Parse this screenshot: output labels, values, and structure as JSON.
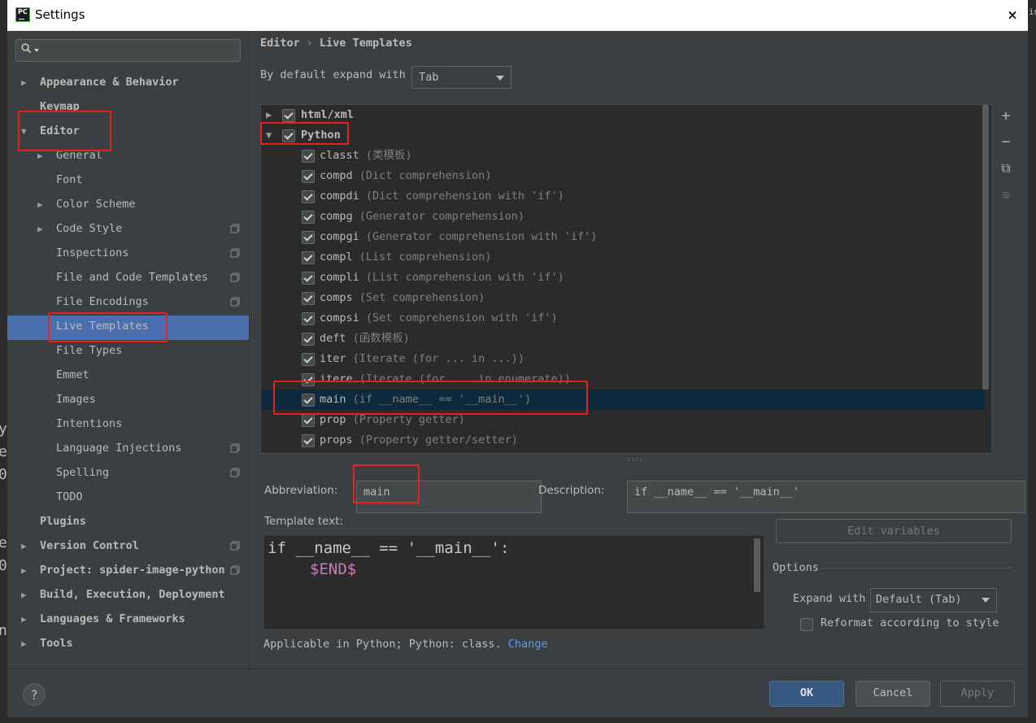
{
  "window": {
    "title": "Settings",
    "app_icon": "pycharm-icon",
    "close_icon": "×"
  },
  "background_text": {
    "left": [
      "y",
      "e",
      "0",
      "e",
      "0",
      "n"
    ],
    "right_top": "in"
  },
  "sidebar": {
    "search_placeholder": "",
    "items": [
      {
        "label": "Appearance & Behavior",
        "level": 0,
        "bold": true,
        "arrow": "▶",
        "copy": false
      },
      {
        "label": "Keymap",
        "level": 0,
        "bold": true,
        "arrow": "",
        "copy": false
      },
      {
        "label": "Editor",
        "level": 0,
        "bold": true,
        "arrow": "▼",
        "copy": false
      },
      {
        "label": "General",
        "level": 1,
        "bold": false,
        "arrow": "▶",
        "copy": false
      },
      {
        "label": "Font",
        "level": 1,
        "bold": false,
        "arrow": "",
        "copy": false
      },
      {
        "label": "Color Scheme",
        "level": 1,
        "bold": false,
        "arrow": "▶",
        "copy": false
      },
      {
        "label": "Code Style",
        "level": 1,
        "bold": false,
        "arrow": "▶",
        "copy": true
      },
      {
        "label": "Inspections",
        "level": 1,
        "bold": false,
        "arrow": "",
        "copy": true
      },
      {
        "label": "File and Code Templates",
        "level": 1,
        "bold": false,
        "arrow": "",
        "copy": true
      },
      {
        "label": "File Encodings",
        "level": 1,
        "bold": false,
        "arrow": "",
        "copy": true
      },
      {
        "label": "Live Templates",
        "level": 1,
        "bold": false,
        "arrow": "",
        "copy": false,
        "selected": true
      },
      {
        "label": "File Types",
        "level": 1,
        "bold": false,
        "arrow": "",
        "copy": false
      },
      {
        "label": "Emmet",
        "level": 1,
        "bold": false,
        "arrow": "",
        "copy": false
      },
      {
        "label": "Images",
        "level": 1,
        "bold": false,
        "arrow": "",
        "copy": false
      },
      {
        "label": "Intentions",
        "level": 1,
        "bold": false,
        "arrow": "",
        "copy": false
      },
      {
        "label": "Language Injections",
        "level": 1,
        "bold": false,
        "arrow": "",
        "copy": true
      },
      {
        "label": "Spelling",
        "level": 1,
        "bold": false,
        "arrow": "",
        "copy": true
      },
      {
        "label": "TODO",
        "level": 1,
        "bold": false,
        "arrow": "",
        "copy": false
      },
      {
        "label": "Plugins",
        "level": 0,
        "bold": true,
        "arrow": "",
        "copy": false
      },
      {
        "label": "Version Control",
        "level": 0,
        "bold": true,
        "arrow": "▶",
        "copy": true
      },
      {
        "label": "Project: spider-image-python",
        "level": 0,
        "bold": true,
        "arrow": "▶",
        "copy": true
      },
      {
        "label": "Build, Execution, Deployment",
        "level": 0,
        "bold": true,
        "arrow": "▶",
        "copy": false
      },
      {
        "label": "Languages & Frameworks",
        "level": 0,
        "bold": true,
        "arrow": "▶",
        "copy": false
      },
      {
        "label": "Tools",
        "level": 0,
        "bold": true,
        "arrow": "▶",
        "copy": false
      }
    ]
  },
  "breadcrumb": {
    "part1": "Editor",
    "separator": "›",
    "part2": "Live Templates"
  },
  "expand_default": {
    "label": "By default expand with",
    "value": "Tab"
  },
  "template_groups": [
    {
      "name": "html/xml",
      "expanded": false,
      "checked": true
    },
    {
      "name": "Python",
      "expanded": true,
      "checked": true
    }
  ],
  "templates": [
    {
      "abbr": "classt",
      "desc": "(类模板)",
      "checked": true
    },
    {
      "abbr": "compd",
      "desc": "(Dict comprehension)",
      "checked": true
    },
    {
      "abbr": "compdi",
      "desc": "(Dict comprehension with 'if')",
      "checked": true
    },
    {
      "abbr": "compg",
      "desc": "(Generator comprehension)",
      "checked": true
    },
    {
      "abbr": "compgi",
      "desc": "(Generator comprehension with 'if')",
      "checked": true
    },
    {
      "abbr": "compl",
      "desc": "(List comprehension)",
      "checked": true
    },
    {
      "abbr": "compli",
      "desc": "(List comprehension with 'if')",
      "checked": true
    },
    {
      "abbr": "comps",
      "desc": "(Set comprehension)",
      "checked": true
    },
    {
      "abbr": "compsi",
      "desc": "(Set comprehension with 'if')",
      "checked": true
    },
    {
      "abbr": "deft",
      "desc": "(函数模板)",
      "checked": true
    },
    {
      "abbr": "iter",
      "desc": "(Iterate (for ... in ...))",
      "checked": true
    },
    {
      "abbr": "itere",
      "desc": "(Iterate (for ... in enumerate))",
      "checked": true
    },
    {
      "abbr": "main",
      "desc": "(if __name__ == '__main__')",
      "checked": true,
      "selected": true
    },
    {
      "abbr": "prop",
      "desc": "(Property getter)",
      "checked": true
    },
    {
      "abbr": "props",
      "desc": "(Property getter/setter)",
      "checked": true
    }
  ],
  "toolbar": {
    "add": "+",
    "remove": "−",
    "copy": "⧉",
    "move": "≡"
  },
  "abbreviation": {
    "label": "Abbreviation:",
    "value": "main"
  },
  "description": {
    "label": "Description:",
    "value": "if __name__ == '__main__'"
  },
  "template_text": {
    "label": "Template text:",
    "line1": "if __name__ == '__main__':",
    "line2": "$END$"
  },
  "edit_variables_label": "Edit variables",
  "options": {
    "title": "Options",
    "expand_with_label": "Expand with",
    "expand_with_value": "Default (Tab)",
    "reformat_label": "Reformat according to style",
    "reformat_checked": false
  },
  "applicable": {
    "text": "Applicable in Python; Python: class.",
    "change_label": "Change"
  },
  "buttons": {
    "help": "?",
    "ok": "OK",
    "cancel": "Cancel",
    "apply": "Apply"
  },
  "colors": {
    "selection": "#4b6eaf",
    "list_selection": "#0d293e",
    "annotation": "#e8201e",
    "link": "#589df6"
  }
}
